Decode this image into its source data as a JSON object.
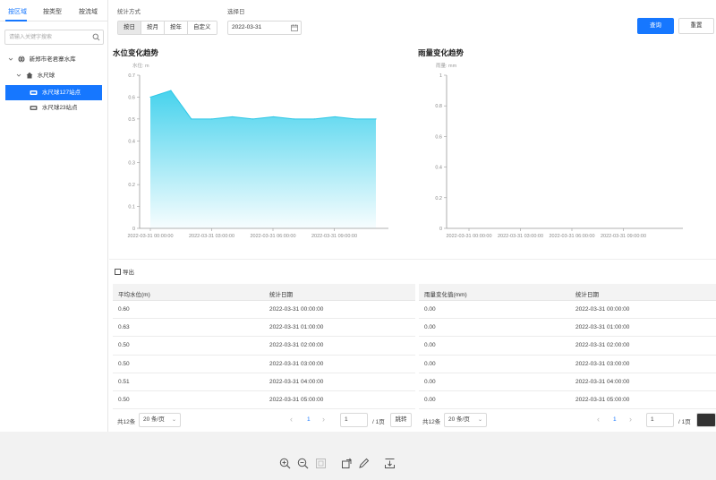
{
  "sidebar": {
    "tabs": [
      "按区域",
      "按类型",
      "按流域"
    ],
    "search_placeholder": "请输入关键字搜索",
    "tree": {
      "root": "新郑市老君寨水库",
      "group": "水尺球",
      "items": [
        "水尺球127站点",
        "水尺球23站点"
      ]
    }
  },
  "toolbar": {
    "stat_label": "统计方式",
    "modes": [
      "按日",
      "按月",
      "按年",
      "自定义"
    ],
    "active_mode": "按日",
    "date_label": "选择日",
    "date_value": "2022-03-31",
    "query_label": "查询",
    "reset_label": "重置"
  },
  "charts": {
    "water": {
      "title": "水位变化趋势",
      "unit": "水位: m"
    },
    "rain": {
      "title": "雨量变化趋势",
      "unit": "雨量: mm"
    }
  },
  "chart_data": [
    {
      "type": "area",
      "title": "水位变化趋势",
      "ylabel": "水位: m",
      "x": [
        "2022-03-31 00:00:00",
        "2022-03-31 01:00:00",
        "2022-03-31 02:00:00",
        "2022-03-31 03:00:00",
        "2022-03-31 04:00:00",
        "2022-03-31 05:00:00",
        "2022-03-31 06:00:00",
        "2022-03-31 07:00:00",
        "2022-03-31 08:00:00",
        "2022-03-31 09:00:00",
        "2022-03-31 10:00:00",
        "2022-03-31 11:00:00"
      ],
      "xticks": [
        "2022-03-31 00:00:00",
        "2022-03-31 03:00:00",
        "2022-03-31 06:00:00",
        "2022-03-31 09:00:00"
      ],
      "values": [
        0.6,
        0.63,
        0.5,
        0.5,
        0.51,
        0.5,
        0.51,
        0.5,
        0.5,
        0.51,
        0.5,
        0.5
      ],
      "yticks": [
        0,
        0.1,
        0.2,
        0.3,
        0.4,
        0.5,
        0.6,
        0.7
      ],
      "ylim": [
        0,
        0.7
      ],
      "color": "#2ec7e6"
    },
    {
      "type": "line",
      "title": "雨量变化趋势",
      "ylabel": "雨量: mm",
      "xticks": [
        "2022-03-31 00:00:00",
        "2022-03-31 03:00:00",
        "2022-03-31 06:00:00",
        "2022-03-31 09:00:00"
      ],
      "values": [
        0,
        0,
        0,
        0,
        0,
        0,
        0,
        0,
        0,
        0,
        0,
        0
      ],
      "yticks": [
        0,
        0.2,
        0.4,
        0.6,
        0.8,
        1
      ],
      "ylim": [
        0,
        1
      ]
    }
  ],
  "export_label": "导出",
  "water_table": {
    "headers": [
      "平均水位(m)",
      "统计日期"
    ],
    "rows": [
      [
        "0.60",
        "2022-03-31 00:00:00"
      ],
      [
        "0.63",
        "2022-03-31 01:00:00"
      ],
      [
        "0.50",
        "2022-03-31 02:00:00"
      ],
      [
        "0.50",
        "2022-03-31 03:00:00"
      ],
      [
        "0.51",
        "2022-03-31 04:00:00"
      ],
      [
        "0.50",
        "2022-03-31 05:00:00"
      ]
    ]
  },
  "rain_table": {
    "headers": [
      "雨量变化值(mm)",
      "统计日期"
    ],
    "rows": [
      [
        "0.00",
        "2022-03-31 00:00:00"
      ],
      [
        "0.00",
        "2022-03-31 01:00:00"
      ],
      [
        "0.00",
        "2022-03-31 02:00:00"
      ],
      [
        "0.00",
        "2022-03-31 03:00:00"
      ],
      [
        "0.00",
        "2022-03-31 04:00:00"
      ],
      [
        "0.00",
        "2022-03-31 05:00:00"
      ]
    ]
  },
  "pager": {
    "total": "共12条",
    "page_size": "20 条/页",
    "current_page": "1",
    "page_input": "1",
    "page_total": "/ 1页",
    "jump": "跳转"
  },
  "viewer_icons": [
    "zoom-in-icon",
    "zoom-out-icon",
    "fit-icon",
    "rotate-icon",
    "pen-icon",
    "download-icon"
  ]
}
